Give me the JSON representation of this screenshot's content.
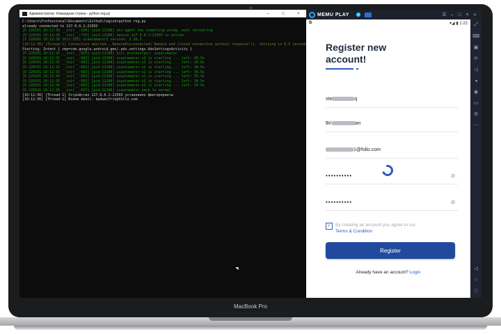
{
  "device": {
    "brand": "MacBook Pro"
  },
  "terminal": {
    "title": "Администратор: Командная строка - python  reg.py",
    "lines": [
      {
        "text": "C:\\Users\\Professional\\Documents\\Github\\legion>python reg.py",
        "tone": "normal"
      },
      {
        "text": "already connected to 127.0.0.1:21503",
        "tone": "normal"
      },
      {
        "text": "[D 220101 10:12:30 __init__:100] [pid:12188] atx-agent has something wrong, auto recovering",
        "tone": "green"
      },
      {
        "text": "[D 220101 10:12:30 __init__:733] [pid:12188] device 127.0.0.1:21503 is online",
        "tone": "green"
      },
      {
        "text": "[I 220101 10:12:30 init:155] uiautomator2 version: 2.16.3",
        "tone": "dim"
      },
      {
        "text": "[10:12:30] [Thread-1] Connection aborted., RemoteDisconnected('Remote end closed connection without response')), retrying in 0.5 seconds",
        "tone": "olive"
      },
      {
        "text": "Starting: Intent { cmp=com.google.android.gms/.ads.settings.AdsSettingsActivity }",
        "tone": "normal"
      },
      {
        "text": "[D 220101 10:12:31 __init__:655] [pid:12188] kill process(ps): uiautomator",
        "tone": "green"
      },
      {
        "text": "[D 220101 10:12:31 __init__:683] [pid:12188] uiautomator-v2 is starting ... left: 40.0s",
        "tone": "green"
      },
      {
        "text": "[D 220101 10:12:31 __init__:683] [pid:12188] uiautomator-v2 is starting ... left: 39.0s",
        "tone": "green"
      },
      {
        "text": "[D 220101 10:12:32 __init__:683] [pid:12188] uiautomator-v2 is starting ... left: 38.0s",
        "tone": "green"
      },
      {
        "text": "[D 220101 10:12:33 __init__:683] [pid:12188] uiautomator-v2 is starting ... left: 36.9s",
        "tone": "green"
      },
      {
        "text": "[D 220101 10:12:34 __init__:683] [pid:12188] uiautomator-v2 is starting ... left: 35.9s",
        "tone": "green"
      },
      {
        "text": "[D 220101 10:12:35 __init__:683] [pid:12188] uiautomator-v2 is starting ... left: 34.9s",
        "tone": "green"
      },
      {
        "text": "[D 220101 10:12:36 __init__:683] [pid:12188] uiautomator-v2 is starting ... left: 33.9s",
        "tone": "green"
      },
      {
        "text": "[D 220101 10:12:36 __init__:697] [pid:12188] uiautomator back to normal",
        "tone": "green"
      },
      {
        "text": "[10:12:36] [Thread-1] Устройство 127.0.0.1:21503 установило фингерпринты",
        "tone": "normal"
      },
      {
        "text": "[10:12:36] [Thread-1] Взяли email: kpdwaifrin@follo.com",
        "tone": "normal"
      }
    ]
  },
  "memu": {
    "app_name": "MEMU PLAY",
    "window_controls": [
      "☰",
      "–",
      "□",
      "×",
      "«"
    ]
  },
  "phone": {
    "status_left": "B",
    "status_right": "▾◢ ▮ 1:22",
    "title_line1": "Register new",
    "title_line2": "account!",
    "fields": {
      "first_prefix": "xte",
      "first_suffix": "q",
      "second_prefix": "Bri",
      "second_suffix": "an",
      "email_suffix": "1@follo.com",
      "password_mask": "••••••••••",
      "confirm_mask": "••••••••••"
    },
    "terms_text": "By creating an account you agree to our",
    "terms_link": "Terms & Condition",
    "register_label": "Register",
    "have_account_text": "Already have an account?",
    "login_label": "Login"
  },
  "sidebar_icons": [
    "expand-icon",
    "keyboard-icon",
    "screenshot-icon",
    "rotate-icon",
    "volume-up-icon",
    "volume-down-icon",
    "location-icon",
    "folder-icon",
    "settings-icon",
    "more-icon"
  ],
  "colors": {
    "accent": "#2e5cb8",
    "button": "#214a9e",
    "terminal_bg": "#0c0c0c",
    "terminal_green": "#13a10e"
  }
}
